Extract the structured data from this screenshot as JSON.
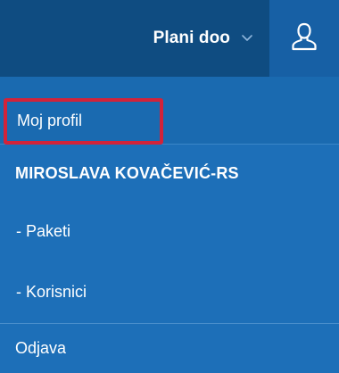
{
  "header": {
    "company_name": "Plani doo",
    "chevron_icon": "chevron-down-icon",
    "user_icon": "user-icon"
  },
  "menu": {
    "my_profile": "Moj profil",
    "organization": "MIROSLAVA KOVAČEVIĆ-RS",
    "packages": "- Paketi",
    "users": "- Korisnici",
    "logout": "Odjava"
  },
  "colors": {
    "header_bg": "#0f4c81",
    "user_area_bg": "#1760a5",
    "menu_bg": "#1d6fb8",
    "highlight": "#d2233a"
  }
}
